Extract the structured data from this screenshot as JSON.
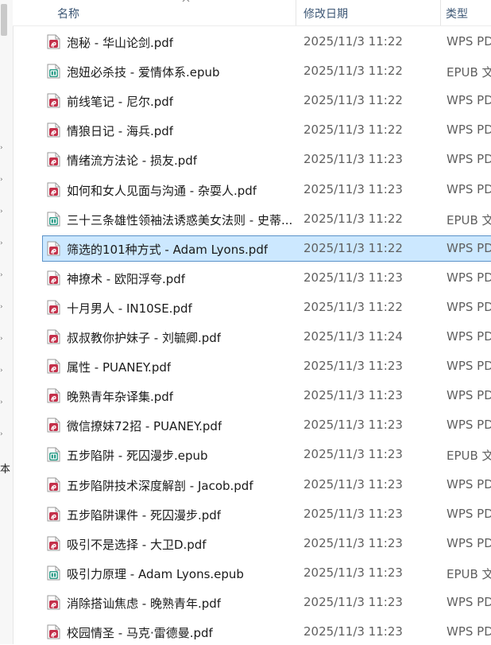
{
  "header": {
    "name_col": "名称",
    "date_col": "修改日期",
    "type_col": "类型"
  },
  "left_pane": {
    "partial_text": "本"
  },
  "files": [
    {
      "name": "泡秘 - 华山论剑.pdf",
      "date": "2025/11/3 11:22",
      "type": "WPS PD",
      "kind": "pdf"
    },
    {
      "name": "泡妞必杀技 - 爱情体系.epub",
      "date": "2025/11/3 11:22",
      "type": "EPUB 文",
      "kind": "epub"
    },
    {
      "name": "前线笔记 - 尼尔.pdf",
      "date": "2025/11/3 11:22",
      "type": "WPS PD",
      "kind": "pdf"
    },
    {
      "name": "情狼日记 - 海兵.pdf",
      "date": "2025/11/3 11:22",
      "type": "WPS PD",
      "kind": "pdf"
    },
    {
      "name": "情绪流方法论 - 损友.pdf",
      "date": "2025/11/3 11:23",
      "type": "WPS PD",
      "kind": "pdf"
    },
    {
      "name": "如何和女人见面与沟通 - 杂耍人.pdf",
      "date": "2025/11/3 11:23",
      "type": "WPS PD",
      "kind": "pdf"
    },
    {
      "name": "三十三条雄性领袖法诱惑美女法则 - 史蒂...",
      "date": "2025/11/3 11:22",
      "type": "EPUB 文",
      "kind": "epub"
    },
    {
      "name": "筛选的101种方式 - Adam Lyons.pdf",
      "date": "2025/11/3 11:22",
      "type": "WPS PD",
      "kind": "pdf",
      "selected": true
    },
    {
      "name": "神撩术 - 欧阳浮夸.pdf",
      "date": "2025/11/3 11:23",
      "type": "WPS PD",
      "kind": "pdf"
    },
    {
      "name": "十月男人 - IN10SE.pdf",
      "date": "2025/11/3 11:22",
      "type": "WPS PD",
      "kind": "pdf"
    },
    {
      "name": "叔叔教你护妹子 - 刘毓卿.pdf",
      "date": "2025/11/3 11:24",
      "type": "WPS PD",
      "kind": "pdf"
    },
    {
      "name": "属性 - PUANEY.pdf",
      "date": "2025/11/3 11:23",
      "type": "WPS PD",
      "kind": "pdf"
    },
    {
      "name": "晚熟青年杂译集.pdf",
      "date": "2025/11/3 11:23",
      "type": "WPS PD",
      "kind": "pdf"
    },
    {
      "name": "微信撩妹72招 - PUANEY.pdf",
      "date": "2025/11/3 11:23",
      "type": "WPS PD",
      "kind": "pdf"
    },
    {
      "name": "五步陷阱 - 死囚漫步.epub",
      "date": "2025/11/3 11:23",
      "type": "EPUB 文",
      "kind": "epub"
    },
    {
      "name": "五步陷阱技术深度解剖 - Jacob.pdf",
      "date": "2025/11/3 11:23",
      "type": "WPS PD",
      "kind": "pdf"
    },
    {
      "name": "五步陷阱课件 - 死囚漫步.pdf",
      "date": "2025/11/3 11:23",
      "type": "WPS PD",
      "kind": "pdf"
    },
    {
      "name": "吸引不是选择 - 大卫D.pdf",
      "date": "2025/11/3 11:23",
      "type": "WPS PD",
      "kind": "pdf"
    },
    {
      "name": "吸引力原理 - Adam Lyons.epub",
      "date": "2025/11/3 11:23",
      "type": "EPUB 文",
      "kind": "epub"
    },
    {
      "name": "消除搭讪焦虑 - 晚熟青年.pdf",
      "date": "2025/11/3 11:23",
      "type": "WPS PD",
      "kind": "pdf"
    },
    {
      "name": "校园情圣 - 马克·雷德曼.pdf",
      "date": "2025/11/3 11:23",
      "type": "WPS PD",
      "kind": "pdf"
    }
  ],
  "colors": {
    "pdf_icon": "#c4314b",
    "epub_icon": "#2f9e8a",
    "selection_bg": "#cce8ff",
    "selection_border": "#5b92c8"
  }
}
